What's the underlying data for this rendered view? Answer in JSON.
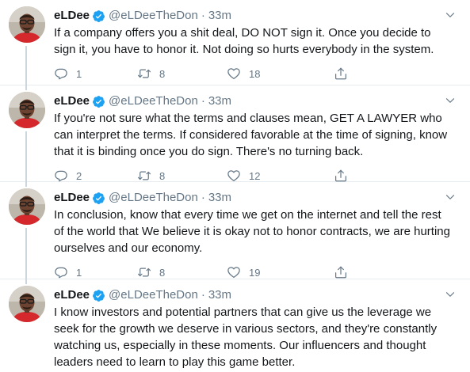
{
  "colors": {
    "verified_badge": "#1da1f2",
    "text_primary": "#14171a",
    "text_secondary": "#657786",
    "thread_line": "#ccd6dd",
    "divider": "#e6ecf0"
  },
  "icons": {
    "verified": "verified-badge-icon",
    "caret": "chevron-down-icon",
    "reply": "reply-icon",
    "retweet": "retweet-icon",
    "like": "heart-icon",
    "share": "share-icon"
  },
  "tweets": [
    {
      "name": "eLDee",
      "handle": "@eLDeeTheDon",
      "separator": "·",
      "time": "33m",
      "text": "If a company offers you a shit deal, DO NOT sign it. Once you decide to sign it, you have to honor it. Not doing so hurts everybody in the system.",
      "replies": "1",
      "retweets": "8",
      "likes": "18"
    },
    {
      "name": "eLDee",
      "handle": "@eLDeeTheDon",
      "separator": "·",
      "time": "33m",
      "text": "If you're not sure what the terms and clauses mean, GET A LAWYER who can interpret the terms. If considered favorable at the time of signing, know that it is binding once you do sign. There's no turning back.",
      "replies": "2",
      "retweets": "8",
      "likes": "12"
    },
    {
      "name": "eLDee",
      "handle": "@eLDeeTheDon",
      "separator": "·",
      "time": "33m",
      "text": "In conclusion, know that every time we get on the internet and tell the rest of the world that We believe it is okay not to honor contracts, we are hurting ourselves and our economy.",
      "replies": "1",
      "retweets": "8",
      "likes": "19"
    },
    {
      "name": "eLDee",
      "handle": "@eLDeeTheDon",
      "separator": "·",
      "time": "33m",
      "text": "I know investors and potential partners that can give us the leverage we seek for the growth we deserve in various sectors, and they're constantly watching us, especially in these moments. Our influencers and thought leaders need to learn to play this game better."
    }
  ]
}
